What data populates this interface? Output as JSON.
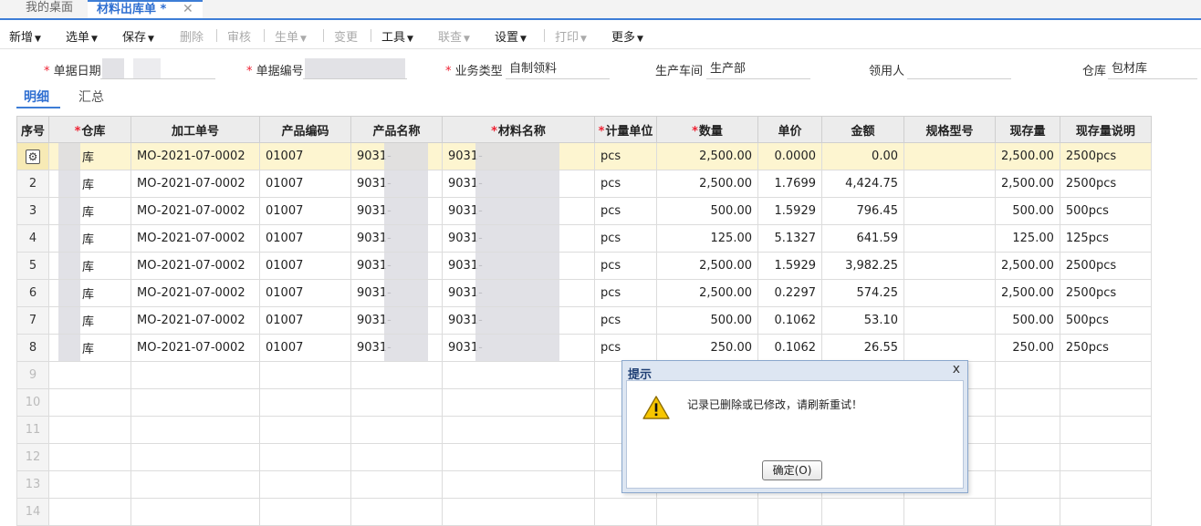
{
  "tabs": {
    "home": "我的桌面",
    "active": "材料出库单 *",
    "close": "✕"
  },
  "toolbar": {
    "items": [
      {
        "label": "新增",
        "caret": true,
        "disabled": false
      },
      {
        "label": "选单",
        "caret": true,
        "disabled": false
      },
      {
        "label": "保存",
        "caret": true,
        "disabled": false
      },
      {
        "label": "删除",
        "caret": false,
        "disabled": true
      },
      {
        "label": "审核",
        "caret": false,
        "disabled": true
      },
      {
        "label": "生单",
        "caret": true,
        "disabled": true
      },
      {
        "label": "变更",
        "caret": false,
        "disabled": true
      },
      {
        "label": "工具",
        "caret": true,
        "disabled": false
      },
      {
        "label": "联查",
        "caret": true,
        "disabled": true
      },
      {
        "label": "设置",
        "caret": true,
        "disabled": false
      },
      {
        "label": "打印",
        "caret": true,
        "disabled": true
      },
      {
        "label": "更多",
        "caret": true,
        "disabled": false
      }
    ]
  },
  "form": {
    "doc_date_label": "单据日期",
    "doc_no_label": "单据编号",
    "biz_type_label": "业务类型",
    "biz_type_value": "自制领料",
    "workshop_label": "生产车间",
    "workshop_value": "生产部",
    "receiver_label": "领用人",
    "receiver_value": "",
    "warehouse_label": "仓库",
    "warehouse_value": "包材库"
  },
  "subtabs": {
    "detail": "明细",
    "summary": "汇总"
  },
  "grid": {
    "headers": [
      {
        "label": "序号",
        "req": false
      },
      {
        "label": "仓库",
        "req": true
      },
      {
        "label": "加工单号",
        "req": false
      },
      {
        "label": "产品编码",
        "req": false
      },
      {
        "label": "产品名称",
        "req": false
      },
      {
        "label": "材料名称",
        "req": true
      },
      {
        "label": "计量单位",
        "req": true
      },
      {
        "label": "数量",
        "req": true
      },
      {
        "label": "单价",
        "req": false
      },
      {
        "label": "金额",
        "req": false
      },
      {
        "label": "规格型号",
        "req": false
      },
      {
        "label": "现存量",
        "req": false
      },
      {
        "label": "现存量说明",
        "req": false
      }
    ],
    "rows": [
      {
        "idx": "",
        "wh": "库",
        "order": "MO-2021-07-0002",
        "pcode": "01007",
        "pname": "9031-",
        "mname": "9031-",
        "unit": "pcs",
        "qty": "2,500.00",
        "price": "0.0000",
        "amount": "0.00",
        "spec": "",
        "stock": "2,500.00",
        "stock_note": "2500pcs"
      },
      {
        "idx": "2",
        "wh": "库",
        "order": "MO-2021-07-0002",
        "pcode": "01007",
        "pname": "9031-",
        "mname": "9031-",
        "unit": "pcs",
        "qty": "2,500.00",
        "price": "1.7699",
        "amount": "4,424.75",
        "spec": "",
        "stock": "2,500.00",
        "stock_note": "2500pcs"
      },
      {
        "idx": "3",
        "wh": "库",
        "order": "MO-2021-07-0002",
        "pcode": "01007",
        "pname": "9031-",
        "mname": "9031-",
        "unit": "pcs",
        "qty": "500.00",
        "price": "1.5929",
        "amount": "796.45",
        "spec": "",
        "stock": "500.00",
        "stock_note": "500pcs"
      },
      {
        "idx": "4",
        "wh": "库",
        "order": "MO-2021-07-0002",
        "pcode": "01007",
        "pname": "9031-",
        "mname": "9031-",
        "unit": "pcs",
        "qty": "125.00",
        "price": "5.1327",
        "amount": "641.59",
        "spec": "",
        "stock": "125.00",
        "stock_note": "125pcs"
      },
      {
        "idx": "5",
        "wh": "库",
        "order": "MO-2021-07-0002",
        "pcode": "01007",
        "pname": "9031-",
        "mname": "9031-",
        "unit": "pcs",
        "qty": "2,500.00",
        "price": "1.5929",
        "amount": "3,982.25",
        "spec": "",
        "stock": "2,500.00",
        "stock_note": "2500pcs"
      },
      {
        "idx": "6",
        "wh": "库",
        "order": "MO-2021-07-0002",
        "pcode": "01007",
        "pname": "9031-",
        "mname": "9031-",
        "unit": "pcs",
        "qty": "2,500.00",
        "price": "0.2297",
        "amount": "574.25",
        "spec": "",
        "stock": "2,500.00",
        "stock_note": "2500pcs"
      },
      {
        "idx": "7",
        "wh": "库",
        "order": "MO-2021-07-0002",
        "pcode": "01007",
        "pname": "9031-",
        "mname": "9031-",
        "unit": "pcs",
        "qty": "500.00",
        "price": "0.1062",
        "amount": "53.10",
        "spec": "",
        "stock": "500.00",
        "stock_note": "500pcs"
      },
      {
        "idx": "8",
        "wh": "库",
        "order": "MO-2021-07-0002",
        "pcode": "01007",
        "pname": "9031-",
        "mname": "9031-",
        "unit": "pcs",
        "qty": "250.00",
        "price": "0.1062",
        "amount": "26.55",
        "spec": "",
        "stock": "250.00",
        "stock_note": "250pcs"
      }
    ],
    "empty_rows": [
      "9",
      "10",
      "11",
      "12",
      "13",
      "14"
    ]
  },
  "dialog": {
    "title": "提示",
    "close": "x",
    "message": "记录已删除或已修改，请刷新重试！",
    "ok_label": "确定(O)"
  }
}
